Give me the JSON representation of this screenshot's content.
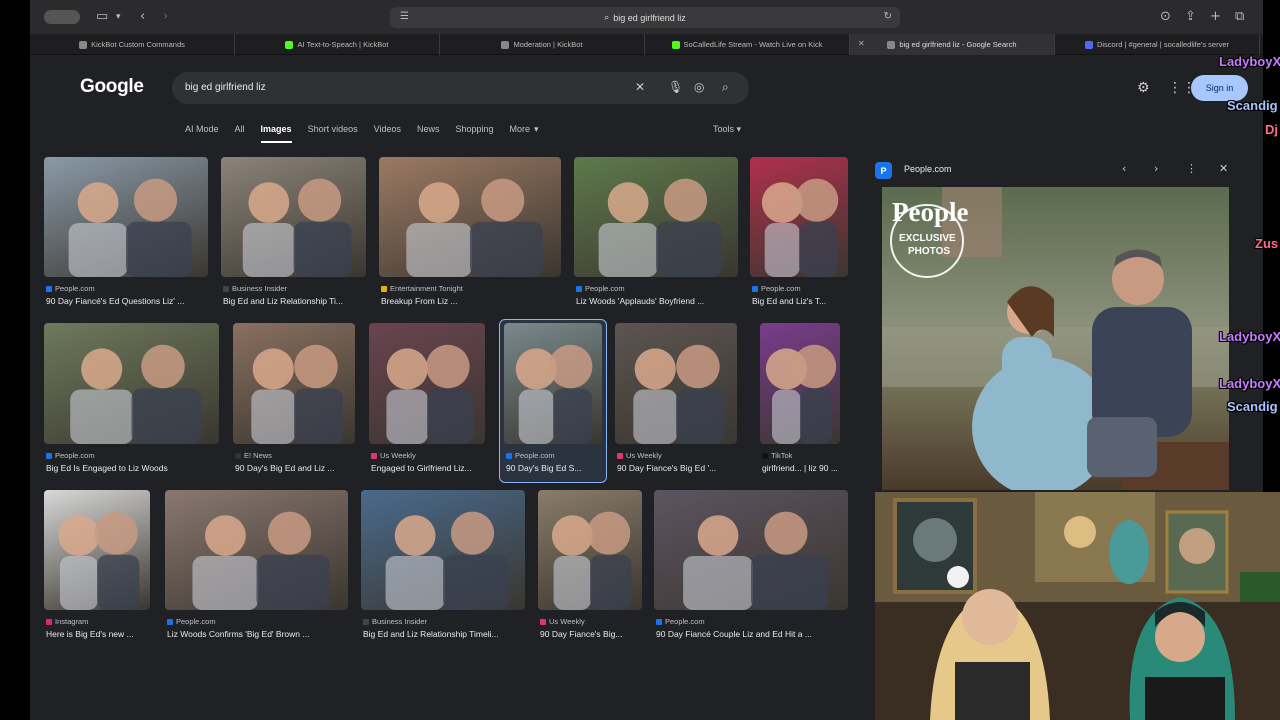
{
  "browser": {
    "url": "big ed girlfriend liz",
    "tabs": [
      {
        "label": "KickBot Custom Commands",
        "color": "#888888"
      },
      {
        "label": "AI Text-to-Speach | KickBot",
        "color": "#53fc18"
      },
      {
        "label": "Moderation | KickBot",
        "color": "#888888"
      },
      {
        "label": "SoCalledLife Stream - Watch Live on Kick",
        "color": "#53fc18"
      },
      {
        "label": "big ed girlfriend liz - Google Search",
        "color": "#888888",
        "active": true
      },
      {
        "label": "Discord | #general | socalledlife's server",
        "color": "#5865f2"
      }
    ]
  },
  "google": {
    "logo": "Google",
    "query": "big ed girlfriend liz",
    "sign_in": "Sign in",
    "nav": [
      "AI Mode",
      "All",
      "Images",
      "Short videos",
      "Videos",
      "News",
      "Shopping",
      "More"
    ],
    "tools": "Tools"
  },
  "results": [
    {
      "source": "People.com",
      "title": "90 Day Fiancé's Ed Questions Liz' ...",
      "src_color": "#1a73e8",
      "bg": "#8a9aa8"
    },
    {
      "source": "Business Insider",
      "title": "Big Ed and Liz Relationship Ti...",
      "src_color": "#444444",
      "bg": "#8c8478"
    },
    {
      "source": "Entertainment Tonight",
      "title": "Breakup From Liz ...",
      "src_color": "#e8b00a",
      "bg": "#9c7a64"
    },
    {
      "source": "People.com",
      "title": "Liz Woods 'Applauds' Boyfriend ...",
      "src_color": "#1a73e8",
      "bg": "#5e7a4c"
    },
    {
      "source": "People.com",
      "title": "Big Ed and Liz's T...",
      "src_color": "#1a73e8",
      "bg": "#b0304c"
    },
    {
      "source": "People.com",
      "title": "Big Ed Is Engaged to Liz Woods",
      "src_color": "#1a73e8",
      "bg": "#6e7a5c"
    },
    {
      "source": "E! News",
      "title": "90 Day's Big Ed and Liz ...",
      "src_color": "#333333",
      "bg": "#8a7060"
    },
    {
      "source": "Us Weekly",
      "title": "Engaged to Girlfriend Liz...",
      "src_color": "#e0356c",
      "bg": "#6a4450"
    },
    {
      "source": "People.com",
      "title": "90 Day's Big Ed S...",
      "src_color": "#1a73e8",
      "bg": "#7a8a8c"
    },
    {
      "source": "Us Weekly",
      "title": "90 Day Fiance's Big Ed '...",
      "src_color": "#e0356c",
      "bg": "#5c5450"
    },
    {
      "source": "TikTok",
      "title": "girlfriend... | liz 90 ...",
      "src_color": "#111111",
      "bg": "#7a3c8c"
    },
    {
      "source": "Instagram",
      "title": "Here is Big Ed's new ...",
      "src_color": "#d6297a",
      "bg": "#d8d8d8"
    },
    {
      "source": "People.com",
      "title": "Liz Woods Confirms 'Big Ed' Brown ...",
      "src_color": "#1a73e8",
      "bg": "#8a7870"
    },
    {
      "source": "Business Insider",
      "title": "Big Ed and Liz Relationship Timeli...",
      "src_color": "#444444",
      "bg": "#4a6a8c"
    },
    {
      "source": "Us Weekly",
      "title": "90 Day Fiance's Big...",
      "src_color": "#e0356c",
      "bg": "#8a7c6a"
    },
    {
      "source": "People.com",
      "title": "90 Day Fiancé Couple Liz and Ed Hit a ...",
      "src_color": "#1a73e8",
      "bg": "#5c5460"
    }
  ],
  "preview": {
    "source": "People.com",
    "badge_title": "People",
    "badge_sub1": "EXCLUSIVE",
    "badge_sub2": "PHOTOS"
  },
  "chat": [
    {
      "text": "LadyboyX",
      "color": "#c77dff"
    },
    {
      "text": "Scandig",
      "color": "#a9c4ff"
    },
    {
      "text": "Dj",
      "color": "#ff6b8a"
    },
    {
      "text": "Zus",
      "color": "#ff6b8a"
    },
    {
      "text": "LadyboyX",
      "color": "#c77dff"
    },
    {
      "text": "LadyboyX",
      "color": "#c77dff"
    },
    {
      "text": "Scandig",
      "color": "#a9c4ff"
    }
  ]
}
